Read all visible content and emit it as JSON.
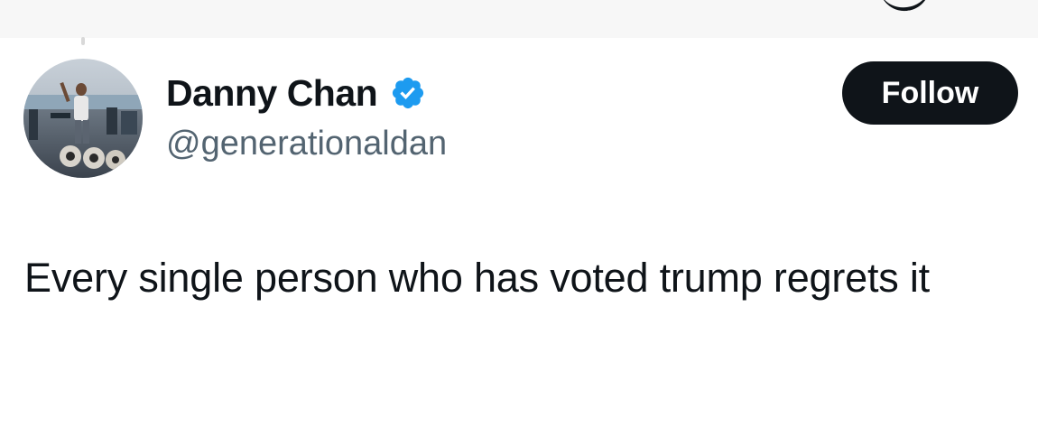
{
  "tweet": {
    "author": {
      "display_name": "Danny Chan",
      "handle": "@generationaldan",
      "verified": true,
      "avatar_icon": "gym-photo-avatar"
    },
    "follow_label": "Follow",
    "text": "Every single person who has voted trump regrets it"
  },
  "colors": {
    "text_primary": "#0f1419",
    "text_secondary": "#536471",
    "verified_blue": "#1d9bf0",
    "button_bg": "#0f1419",
    "button_text": "#ffffff"
  }
}
